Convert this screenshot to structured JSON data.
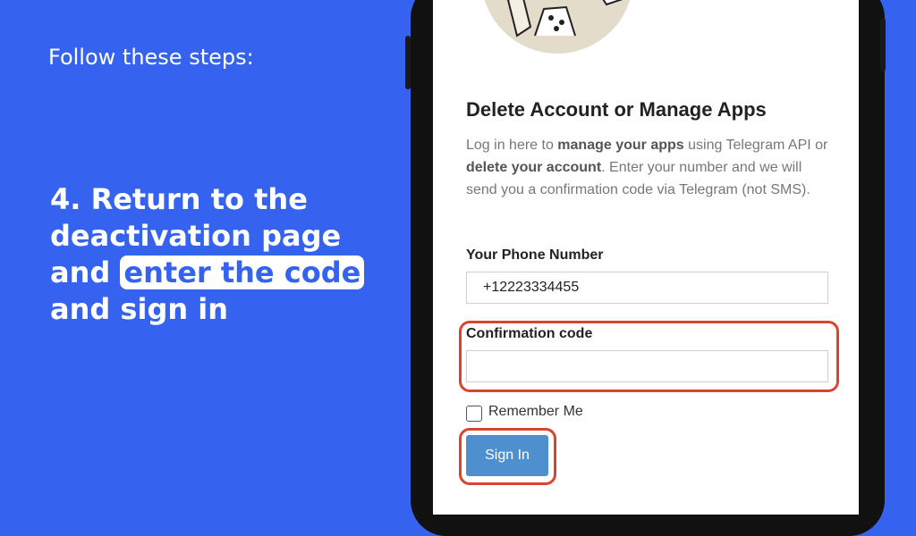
{
  "intro": "Follow these steps:",
  "step": {
    "before": "4. Return to the deactivation page and ",
    "highlight": "enter the code",
    "after": " and sign in"
  },
  "page": {
    "title": "Delete Account or Manage Apps",
    "desc": {
      "p1": "Log in here to ",
      "b1": "manage your apps",
      "p2": " using Telegram API or ",
      "b2": "delete your account",
      "p3": ". Enter your number and we will send you a confirmation code via Telegram (not SMS)."
    },
    "phone_label": "Your Phone Number",
    "phone_value": "+12223334455",
    "code_label": "Confirmation code",
    "code_value": "",
    "remember_label": "Remember Me",
    "signin_label": "Sign In"
  },
  "colors": {
    "background": "#3563f0",
    "highlight_ring": "#d9442e",
    "button": "#4d8fcf"
  }
}
